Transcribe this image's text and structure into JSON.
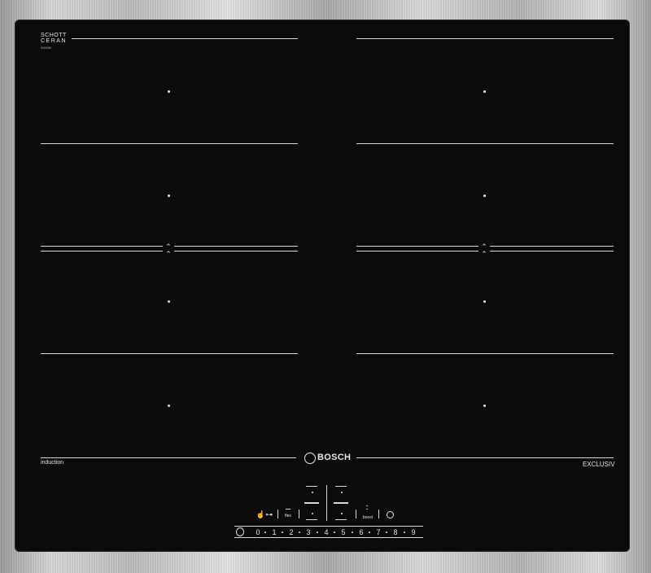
{
  "hob": {
    "glass_brand_line1": "SCHOTT",
    "glass_brand_line2": "CERAN",
    "glass_code": "000000",
    "label_left": "induction",
    "brand_name": "BOSCH",
    "label_right": "EXCLUSIV",
    "zones_left": [
      "zone-left-1",
      "zone-left-2",
      "zone-left-3",
      "zone-left-4"
    ],
    "zones_right": [
      "zone-right-1",
      "zone-right-2",
      "zone-right-3",
      "zone-right-4"
    ]
  },
  "controls": {
    "lock_label": "☝⊶",
    "flex_label": "flex",
    "boost_label": "boost",
    "timer_icon": "clock-icon",
    "power_icon": "power-icon",
    "slider_values": [
      "0",
      "1",
      "2",
      "3",
      "4",
      "5",
      "6",
      "7",
      "8",
      "9"
    ]
  },
  "colors": {
    "glass": "#0b0b0c",
    "markings": "#d8d8d8",
    "frame": "#b9bbbd"
  }
}
